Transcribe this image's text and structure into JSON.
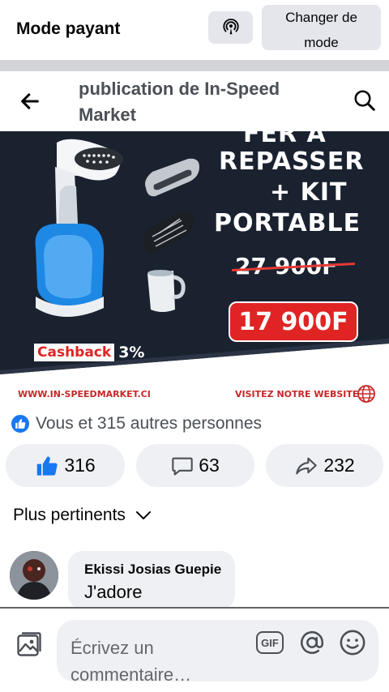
{
  "mode_bar": {
    "title": "Mode payant",
    "change_mode_line1": "Changer de",
    "change_mode_line2": "mode",
    "icon": "broadcast-icon"
  },
  "header": {
    "title_line1": "publication de In-Speed",
    "title_line2": "Market",
    "back_icon": "arrow-left-icon",
    "search_icon": "search-icon"
  },
  "banner": {
    "line_top": "FER A",
    "line1": "REPASSER",
    "line2": "+ KIT",
    "line3": "PORTABLE",
    "old_price": "27 900F",
    "new_price": "17 900F",
    "cashback_label": "Cashback",
    "cashback_value": "3%",
    "website": "WWW.IN-SPEEDMARKET.CI",
    "visit": "VISITEZ NOTRE WEBSITE",
    "colors": {
      "background": "#1a2230",
      "accent_red": "#e02424",
      "steamer_blue": "#1e88e5"
    }
  },
  "reactions": {
    "summary": "Vous et 315 autres personnes",
    "like_count": "316",
    "comment_count": "63",
    "share_count": "232"
  },
  "sort": {
    "label": "Plus pertinents"
  },
  "comment": {
    "author": "Ekissi Josias Guepie",
    "text": "J'adore"
  },
  "composer": {
    "placeholder_line1": "Écrivez un",
    "placeholder_line2": "commentaire…",
    "gif_label": "GIF"
  },
  "colors": {
    "facebook_blue": "#1877f2",
    "button_grey": "#eef0f3",
    "text_secondary": "#65676b"
  }
}
